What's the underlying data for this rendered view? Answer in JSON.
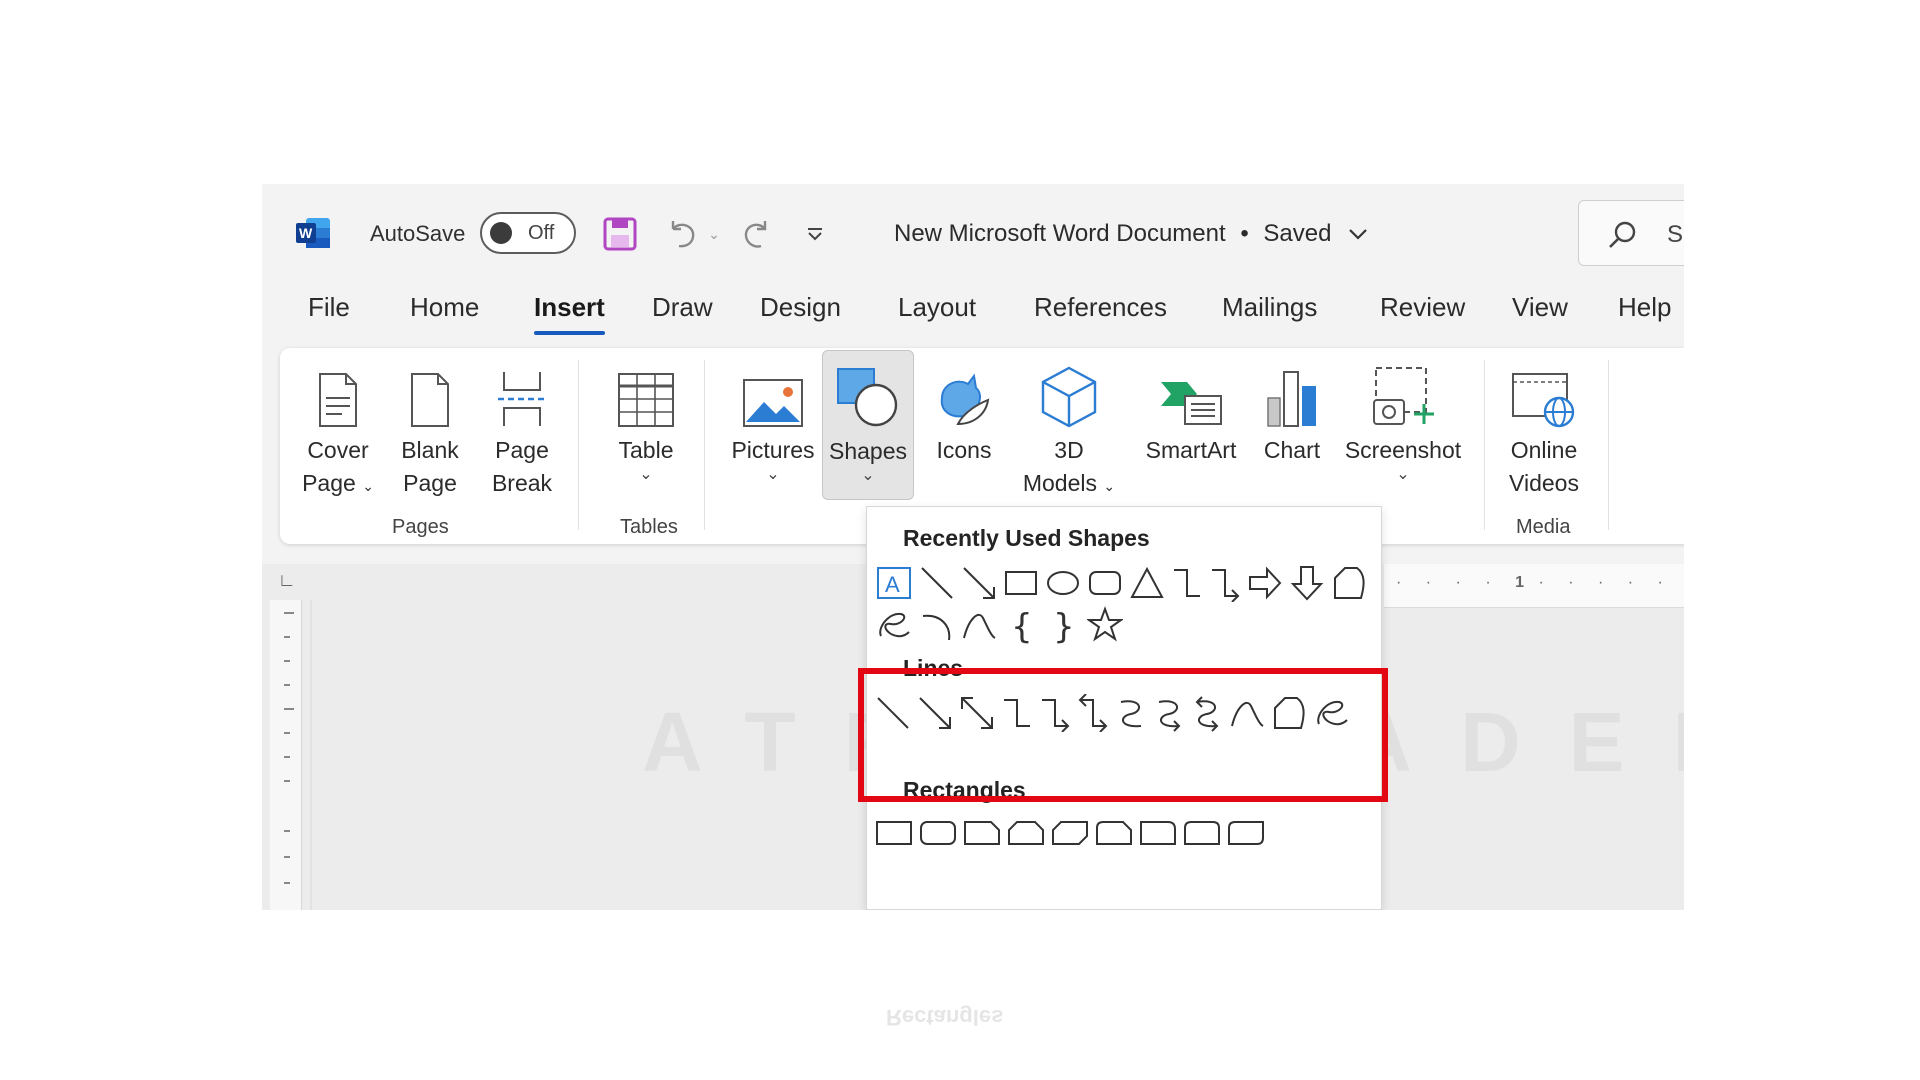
{
  "titlebar": {
    "app_icon": "word-icon",
    "autosave_label": "AutoSave",
    "autosave_state": "Off",
    "doc_title": "New Microsoft Word Document",
    "separator": "•",
    "save_status": "Saved",
    "search_hint": "S"
  },
  "tabs": [
    {
      "label": "File"
    },
    {
      "label": "Home"
    },
    {
      "label": "Insert"
    },
    {
      "label": "Draw"
    },
    {
      "label": "Design"
    },
    {
      "label": "Layout"
    },
    {
      "label": "References"
    },
    {
      "label": "Mailings"
    },
    {
      "label": "Review"
    },
    {
      "label": "View"
    },
    {
      "label": "Help"
    }
  ],
  "active_tab": "Insert",
  "ribbon": {
    "cover_page": {
      "line1": "Cover",
      "line2": "Page"
    },
    "blank_page": {
      "line1": "Blank",
      "line2": "Page"
    },
    "page_break": {
      "line1": "Page",
      "line2": "Break"
    },
    "table": {
      "line1": "Table"
    },
    "pictures": {
      "line1": "Pictures"
    },
    "shapes": {
      "line1": "Shapes"
    },
    "icons": {
      "line1": "Icons"
    },
    "models_3d": {
      "line1": "3D",
      "line2": "Models"
    },
    "smartart": {
      "line1": "SmartArt"
    },
    "chart": {
      "line1": "Chart"
    },
    "screenshot": {
      "line1": "Screenshot"
    },
    "online_videos": {
      "line1": "Online",
      "line2": "Videos"
    },
    "groups": {
      "pages": "Pages",
      "tables": "Tables",
      "media": "Media"
    }
  },
  "shapes_menu": {
    "recent_heading": "Recently Used Shapes",
    "lines_heading": "Lines",
    "rectangles_heading": "Rectangles",
    "recent_row1": [
      "text-box-icon",
      "line-icon",
      "arrow-line-icon",
      "rectangle-icon",
      "oval-icon",
      "rounded-rectangle-icon",
      "triangle-icon",
      "elbow-connector-icon",
      "elbow-arrow-connector-icon",
      "right-arrow-icon",
      "down-arrow-icon",
      "freeform-icon"
    ],
    "recent_row2": [
      "scribble-icon",
      "arc-icon",
      "curve-icon",
      "left-brace-icon",
      "right-brace-icon",
      "star-icon"
    ],
    "lines": [
      "line-icon",
      "arrow-line-icon",
      "double-arrow-line-icon",
      "elbow-connector-icon",
      "elbow-arrow-connector-icon",
      "elbow-double-arrow-connector-icon",
      "curved-connector-icon",
      "curved-arrow-connector-icon",
      "curved-double-arrow-connector-icon",
      "curve-icon",
      "freeform-icon",
      "scribble-icon"
    ],
    "rectangles": [
      "rectangle-icon",
      "rounded-rectangle-icon",
      "snip-single-corner-icon",
      "snip-same-side-icon",
      "snip-diagonal-icon",
      "snip-round-icon",
      "round-single-corner-icon",
      "round-same-side-icon",
      "round-diagonal-icon"
    ],
    "highlight_color": "#e30613"
  },
  "ruler": {
    "marker": "1"
  },
  "watermark": "ATRO ACADEMY",
  "colors": {
    "accent": "#185abd",
    "word_blue": "#185abd",
    "save_purple": "#b146c2"
  }
}
